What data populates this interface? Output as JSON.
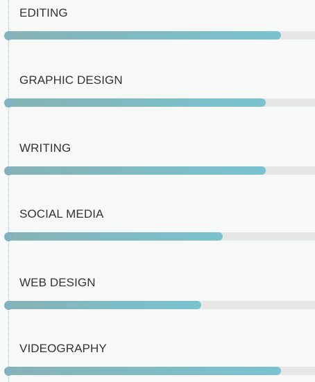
{
  "skills": [
    {
      "name": "EDITING",
      "level": 0.89
    },
    {
      "name": "GRAPHIC DESIGN",
      "level": 0.84
    },
    {
      "name": "WRITING",
      "level": 0.84
    },
    {
      "name": "SOCIAL MEDIA",
      "level": 0.7
    },
    {
      "name": "WEB DESIGN",
      "level": 0.63
    },
    {
      "name": "VIDEOGRAPHY",
      "level": 0.89
    }
  ],
  "colors": {
    "fill_start": "#86b3b6",
    "fill_end": "#79c2d0",
    "track": "#e6e6e6",
    "dot": "#82b2bf",
    "label": "#333333"
  }
}
